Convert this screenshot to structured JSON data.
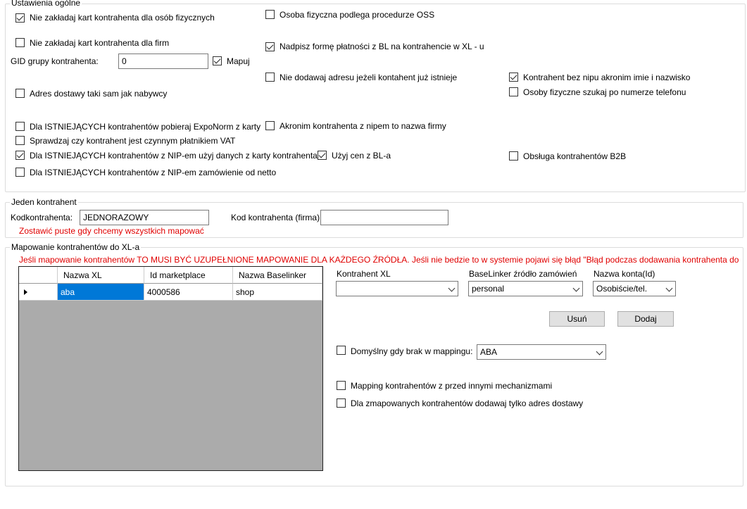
{
  "general": {
    "title": "Ustawienia ogólne",
    "opt_no_person_cards": "Nie zakładaj kart kontrahenta dla osób fizycznych",
    "opt_no_company_cards": "Nie zakładaj kart kontrahenta dla firm",
    "gid_label": "GID grupy kontrahenta:",
    "gid_value": "0",
    "map_label": "Mapuj",
    "opt_delivery_same": "Adres dostawy taki sam jak nabywcy",
    "opt_oss": "Osoba fizyczna podlega procedurze OSS",
    "opt_overwrite_payment": "Nadpisz formę płatności z BL na kontrahencie w XL - u",
    "opt_no_address": "Nie dodawaj adresu jeżeli kontahent już istnieje",
    "opt_acronym_no_nip": "Kontrahent bez nipu akronim imie i nazwisko",
    "opt_search_phone": "Osoby fizyczne szukaj po numerze telefonu",
    "opt_exponorm": "Dla ISTNIEJĄCYCH kontrahentów pobieraj ExpoNorm z karty",
    "opt_acronym_nip": "Akronim kontrahenta z nipem to nazwa firmy",
    "opt_vat_check": "Sprawdzaj czy kontrahent jest czynnym płatnikiem VAT",
    "opt_nip_card_data": "Dla ISTNIEJĄCYCH kontrahentów z NIP-em użyj danych z karty kontrahenta",
    "opt_bl_prices": "Użyj cen z BL-a",
    "opt_b2b": "Obsługa kontrahentów B2B",
    "opt_nip_net_order": "Dla ISTNIEJĄCYCH kontrahentów z NIP-em zamówienie od netto"
  },
  "single": {
    "title": "Jeden kontrahent",
    "code_label": "Kodkontrahenta:",
    "code_value": "JEDNORAZOWY",
    "company_code_label": "Kod kontrahenta (firma):",
    "company_code_value": "",
    "hint": "Zostawić puste gdy chcemy wszystkich mapować"
  },
  "mapping": {
    "title": "Mapowanie kontrahentów do XL-a",
    "warning": "Jeśli mapowanie kontrahentów TO MUSI BYĆ UZUPEŁNIONE MAPOWANIE DLA KAŻDEGO ŹRÓDŁA. Jeśli nie bedzie to w systemie pojawi się błąd \"Błąd podczas dodawania kontrahenta  do dokument",
    "grid_headers": [
      "Nazwa XL",
      "Id marketplace",
      "Nazwa Baselinker"
    ],
    "grid_rows": [
      [
        "aba",
        "4000586",
        "shop"
      ]
    ],
    "xl_label": "Kontrahent XL",
    "xl_value": "",
    "source_label": "BaseLinker źródło zamówień",
    "source_value": "personal",
    "account_label": "Nazwa konta(Id)",
    "account_value": "Osobiście/tel.",
    "delete_btn": "Usuń",
    "add_btn": "Dodaj",
    "default_label": "Domyślny gdy brak w mappingu:",
    "default_value": "ABA",
    "opt_mapping_before": "Mapping kontrahentów z przed innymi mechanizmami",
    "opt_delivery_only": "Dla zmapowanych kontrahentów dodawaj tylko adres dostawy"
  }
}
